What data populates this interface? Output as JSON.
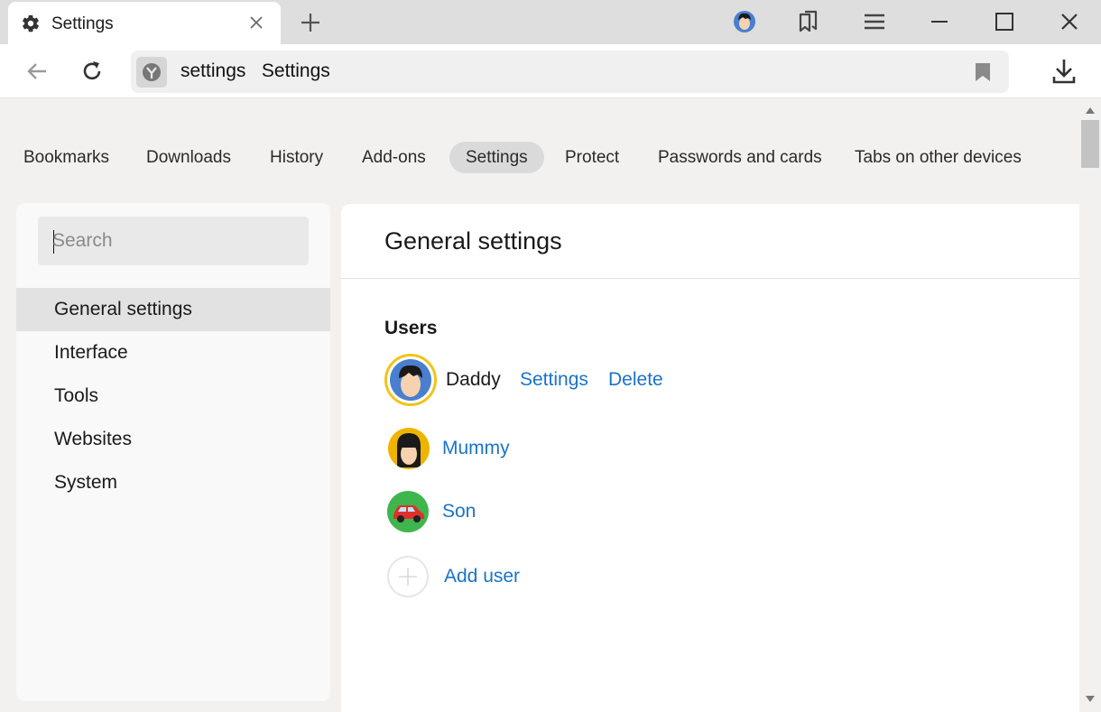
{
  "tab": {
    "title": "Settings",
    "icon": "gear-icon"
  },
  "omnibox": {
    "host": "settings",
    "title": "Settings"
  },
  "sections": [
    {
      "label": "Bookmarks",
      "active": false
    },
    {
      "label": "Downloads",
      "active": false
    },
    {
      "label": "History",
      "active": false
    },
    {
      "label": "Add-ons",
      "active": false
    },
    {
      "label": "Settings",
      "active": true
    },
    {
      "label": "Protect",
      "active": false
    },
    {
      "label": "Passwords and cards",
      "active": false
    },
    {
      "label": "Tabs on other devices",
      "active": false
    }
  ],
  "sidebar": {
    "search_placeholder": "Search",
    "items": [
      {
        "label": "General settings",
        "active": true
      },
      {
        "label": "Interface",
        "active": false
      },
      {
        "label": "Tools",
        "active": false
      },
      {
        "label": "Websites",
        "active": false
      },
      {
        "label": "System",
        "active": false
      }
    ]
  },
  "main": {
    "title": "General settings",
    "users_heading": "Users",
    "current_user": {
      "name": "Daddy",
      "settings_link": "Settings",
      "delete_link": "Delete"
    },
    "other_users": [
      {
        "name": "Mummy"
      },
      {
        "name": "Son"
      }
    ],
    "add_user": "Add user"
  },
  "colors": {
    "link": "#1a73c9",
    "current_user_ring": "#f0c419",
    "active_bg": "#dadada"
  }
}
